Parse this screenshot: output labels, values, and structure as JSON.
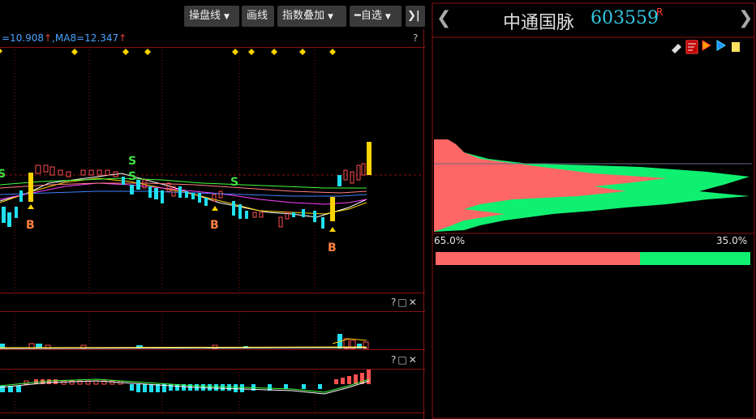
{
  "toolbar": {
    "draw_label": "操盘线",
    "line_label": "画线",
    "overlay_label": "指数叠加",
    "watchlist_label": "━自选",
    "collapse_label": "❯|"
  },
  "ma_legend": {
    "ma_text": "=10.908",
    "ma8_text": ",MA8=12.347"
  },
  "signals": {
    "s_label": "S",
    "b_label": "B"
  },
  "panel_tools": {
    "help": "?",
    "box": "□",
    "close": "✕"
  },
  "stock": {
    "name": "中通国脉",
    "code": "603559",
    "badge": "R"
  },
  "chip_distribution": {
    "profit_pct": "65.0%",
    "loss_pct": "35.0%",
    "profit_ratio": 0.65,
    "profit_color": "#ff6666",
    "loss_color": "#10f070"
  },
  "colors": {
    "up": "#ff5050",
    "down": "#20e0f0",
    "grid": "#8a1010",
    "signal_yellow": "#ffd400"
  }
}
